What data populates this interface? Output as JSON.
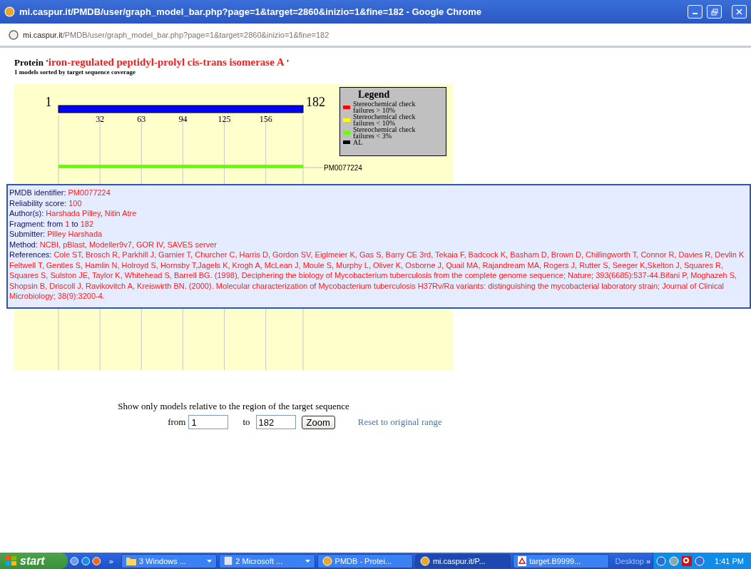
{
  "window": {
    "title": "mi.caspur.it/PMDB/user/graph_model_bar.php?page=1&target=2860&inizio=1&fine=182 - Google Chrome"
  },
  "address": {
    "host": "mi.caspur.it",
    "path": "/PMDB/user/graph_model_bar.php?page=1&target=2860&inizio=1&fine=182"
  },
  "heading": {
    "prefix": "Protein '",
    "protein": "iron-regulated peptidyl-prolyl cis-trans isomerase A",
    "suffix": " '",
    "subtitle": "1 models sorted by target sequence coverage"
  },
  "graph": {
    "start": "1",
    "end": "182",
    "ticks": [
      "32",
      "63",
      "94",
      "125",
      "156"
    ],
    "legend": {
      "title": "Legend",
      "items": [
        {
          "label": "Stereochemical check failures > 10%",
          "color": "#ff0000"
        },
        {
          "label": "Stereochemical check failures < 10%",
          "color": "#ffff00"
        },
        {
          "label": "Stereochemical check failures < 3%",
          "color": "#66ff00"
        },
        {
          "label": "AL",
          "color": "#000000"
        }
      ]
    },
    "models": [
      {
        "id": "PM0077224",
        "color": "#66ff00"
      }
    ]
  },
  "popup": {
    "fields": [
      {
        "parts": [
          {
            "text": "PMDB identifier: ",
            "highlight": false
          },
          {
            "text": "PM0077224",
            "highlight": true
          }
        ]
      },
      {
        "parts": [
          {
            "text": "Reliability score: ",
            "highlight": false
          },
          {
            "text": "100",
            "highlight": true
          }
        ]
      },
      {
        "parts": [
          {
            "text": "Author(s): ",
            "highlight": false
          },
          {
            "text": "Harshada Pilley",
            "highlight": true
          },
          {
            "text": ", ",
            "highlight": false
          },
          {
            "text": "Nitin Atre",
            "highlight": true
          }
        ]
      },
      {
        "parts": [
          {
            "text": "Fragment: from ",
            "highlight": false
          },
          {
            "text": "1",
            "highlight": true
          },
          {
            "text": " to ",
            "highlight": false
          },
          {
            "text": "182",
            "highlight": true
          }
        ]
      },
      {
        "parts": [
          {
            "text": "Submitter: ",
            "highlight": false
          },
          {
            "text": "Pilley Harshada",
            "highlight": true
          }
        ]
      },
      {
        "parts": [
          {
            "text": "Method: ",
            "highlight": false
          },
          {
            "text": "NCBI, pBlast, Modeller9v7, GOR IV, SAVES server",
            "highlight": true
          }
        ]
      },
      {
        "parts": [
          {
            "text": "References: ",
            "highlight": false
          },
          {
            "text": "Cole ST, Brosch R, Parkhill J, Garnier T, Churcher C, Harris D, Gordon SV, Eiglmeier K, Gas S, Barry CE 3rd, Tekaia F, Badcock K, Basham D, Brown D, Chillingworth T, Connor R, Davies R, Devlin K Feltwell T, Gentles S, Hamlin N, Holroyd S, Hornsby T,Jagels K, Krogh A, McLean J, Moule S, Murphy L, Oliver K, Osborne J, Quail MA, Rajandream MA, Rogers J, Rutter S, Seeger K,Skelton J, Squares R, Squares S, Sulston JE, Taylor K, Whitehead S, Barrell BG. (1998), Deciphering the biology of Mycobacterium tuberculosis from the complete genome sequence; Nature; 393(6685):537-44.Bifani P, Moghazeh S, Shopsin B, Driscoll J, Ravikovitch A, Kreiswirth BN. (2000). Molecular characterization of Mycobacterium tuberculosis H37Rv/Ra variants: distinguishing the mycobacterial laboratory strain; Journal of Clinical Microbiology; 38(9):3200-4.",
            "highlight": true
          }
        ]
      }
    ]
  },
  "range_form": {
    "caption": "Show only models relative to the region of the target sequence",
    "from_label": "from",
    "from_value": "1",
    "to_label": "to",
    "to_value": "182",
    "button": "Zoom",
    "reset_link": "Reset to original range"
  },
  "taskbar": {
    "start": "start",
    "more": "»",
    "tasks": [
      {
        "label": "3 Windows ...",
        "kind": "folder",
        "selected": false,
        "menu": true
      },
      {
        "label": "2 Microsoft ...",
        "kind": "word",
        "selected": false,
        "menu": true
      },
      {
        "label": "PMDB - Protei...",
        "kind": "chrome",
        "selected": false,
        "menu": false
      },
      {
        "label": "mi.caspur.it/P...",
        "kind": "chrome",
        "selected": true,
        "menu": false
      },
      {
        "label": "target.B9999...",
        "kind": "pdf",
        "selected": false,
        "menu": false
      }
    ],
    "desktop": "Desktop",
    "tray_more": "»",
    "clock": "1:41 PM"
  }
}
